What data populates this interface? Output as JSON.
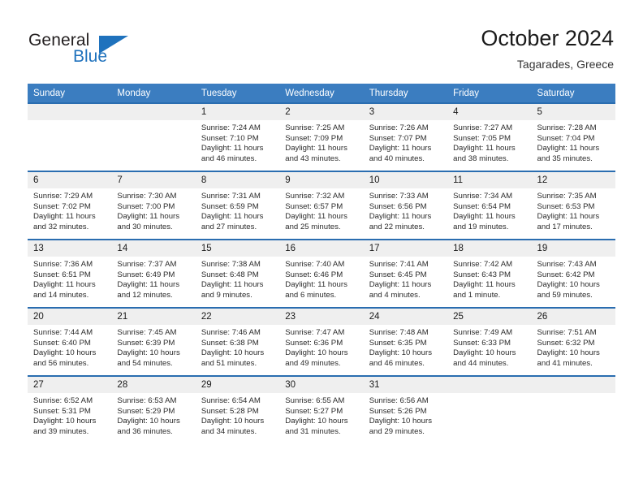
{
  "logo": {
    "text_top": "General",
    "text_bottom": "Blue",
    "accent_color": "#1f72bd"
  },
  "header": {
    "title": "October 2024",
    "location": "Tagarades, Greece"
  },
  "theme": {
    "header_row_bg": "#3b7dc0",
    "row_divider": "#2a6db0",
    "daynum_bg": "#efefef"
  },
  "calendar": {
    "weekday_headers": [
      "Sunday",
      "Monday",
      "Tuesday",
      "Wednesday",
      "Thursday",
      "Friday",
      "Saturday"
    ],
    "weeks": [
      [
        {
          "day": "",
          "sunrise": "",
          "sunset": "",
          "daylight_line1": "",
          "daylight_line2": ""
        },
        {
          "day": "",
          "sunrise": "",
          "sunset": "",
          "daylight_line1": "",
          "daylight_line2": ""
        },
        {
          "day": "1",
          "sunrise": "Sunrise: 7:24 AM",
          "sunset": "Sunset: 7:10 PM",
          "daylight_line1": "Daylight: 11 hours",
          "daylight_line2": "and 46 minutes."
        },
        {
          "day": "2",
          "sunrise": "Sunrise: 7:25 AM",
          "sunset": "Sunset: 7:09 PM",
          "daylight_line1": "Daylight: 11 hours",
          "daylight_line2": "and 43 minutes."
        },
        {
          "day": "3",
          "sunrise": "Sunrise: 7:26 AM",
          "sunset": "Sunset: 7:07 PM",
          "daylight_line1": "Daylight: 11 hours",
          "daylight_line2": "and 40 minutes."
        },
        {
          "day": "4",
          "sunrise": "Sunrise: 7:27 AM",
          "sunset": "Sunset: 7:05 PM",
          "daylight_line1": "Daylight: 11 hours",
          "daylight_line2": "and 38 minutes."
        },
        {
          "day": "5",
          "sunrise": "Sunrise: 7:28 AM",
          "sunset": "Sunset: 7:04 PM",
          "daylight_line1": "Daylight: 11 hours",
          "daylight_line2": "and 35 minutes."
        }
      ],
      [
        {
          "day": "6",
          "sunrise": "Sunrise: 7:29 AM",
          "sunset": "Sunset: 7:02 PM",
          "daylight_line1": "Daylight: 11 hours",
          "daylight_line2": "and 32 minutes."
        },
        {
          "day": "7",
          "sunrise": "Sunrise: 7:30 AM",
          "sunset": "Sunset: 7:00 PM",
          "daylight_line1": "Daylight: 11 hours",
          "daylight_line2": "and 30 minutes."
        },
        {
          "day": "8",
          "sunrise": "Sunrise: 7:31 AM",
          "sunset": "Sunset: 6:59 PM",
          "daylight_line1": "Daylight: 11 hours",
          "daylight_line2": "and 27 minutes."
        },
        {
          "day": "9",
          "sunrise": "Sunrise: 7:32 AM",
          "sunset": "Sunset: 6:57 PM",
          "daylight_line1": "Daylight: 11 hours",
          "daylight_line2": "and 25 minutes."
        },
        {
          "day": "10",
          "sunrise": "Sunrise: 7:33 AM",
          "sunset": "Sunset: 6:56 PM",
          "daylight_line1": "Daylight: 11 hours",
          "daylight_line2": "and 22 minutes."
        },
        {
          "day": "11",
          "sunrise": "Sunrise: 7:34 AM",
          "sunset": "Sunset: 6:54 PM",
          "daylight_line1": "Daylight: 11 hours",
          "daylight_line2": "and 19 minutes."
        },
        {
          "day": "12",
          "sunrise": "Sunrise: 7:35 AM",
          "sunset": "Sunset: 6:53 PM",
          "daylight_line1": "Daylight: 11 hours",
          "daylight_line2": "and 17 minutes."
        }
      ],
      [
        {
          "day": "13",
          "sunrise": "Sunrise: 7:36 AM",
          "sunset": "Sunset: 6:51 PM",
          "daylight_line1": "Daylight: 11 hours",
          "daylight_line2": "and 14 minutes."
        },
        {
          "day": "14",
          "sunrise": "Sunrise: 7:37 AM",
          "sunset": "Sunset: 6:49 PM",
          "daylight_line1": "Daylight: 11 hours",
          "daylight_line2": "and 12 minutes."
        },
        {
          "day": "15",
          "sunrise": "Sunrise: 7:38 AM",
          "sunset": "Sunset: 6:48 PM",
          "daylight_line1": "Daylight: 11 hours",
          "daylight_line2": "and 9 minutes."
        },
        {
          "day": "16",
          "sunrise": "Sunrise: 7:40 AM",
          "sunset": "Sunset: 6:46 PM",
          "daylight_line1": "Daylight: 11 hours",
          "daylight_line2": "and 6 minutes."
        },
        {
          "day": "17",
          "sunrise": "Sunrise: 7:41 AM",
          "sunset": "Sunset: 6:45 PM",
          "daylight_line1": "Daylight: 11 hours",
          "daylight_line2": "and 4 minutes."
        },
        {
          "day": "18",
          "sunrise": "Sunrise: 7:42 AM",
          "sunset": "Sunset: 6:43 PM",
          "daylight_line1": "Daylight: 11 hours",
          "daylight_line2": "and 1 minute."
        },
        {
          "day": "19",
          "sunrise": "Sunrise: 7:43 AM",
          "sunset": "Sunset: 6:42 PM",
          "daylight_line1": "Daylight: 10 hours",
          "daylight_line2": "and 59 minutes."
        }
      ],
      [
        {
          "day": "20",
          "sunrise": "Sunrise: 7:44 AM",
          "sunset": "Sunset: 6:40 PM",
          "daylight_line1": "Daylight: 10 hours",
          "daylight_line2": "and 56 minutes."
        },
        {
          "day": "21",
          "sunrise": "Sunrise: 7:45 AM",
          "sunset": "Sunset: 6:39 PM",
          "daylight_line1": "Daylight: 10 hours",
          "daylight_line2": "and 54 minutes."
        },
        {
          "day": "22",
          "sunrise": "Sunrise: 7:46 AM",
          "sunset": "Sunset: 6:38 PM",
          "daylight_line1": "Daylight: 10 hours",
          "daylight_line2": "and 51 minutes."
        },
        {
          "day": "23",
          "sunrise": "Sunrise: 7:47 AM",
          "sunset": "Sunset: 6:36 PM",
          "daylight_line1": "Daylight: 10 hours",
          "daylight_line2": "and 49 minutes."
        },
        {
          "day": "24",
          "sunrise": "Sunrise: 7:48 AM",
          "sunset": "Sunset: 6:35 PM",
          "daylight_line1": "Daylight: 10 hours",
          "daylight_line2": "and 46 minutes."
        },
        {
          "day": "25",
          "sunrise": "Sunrise: 7:49 AM",
          "sunset": "Sunset: 6:33 PM",
          "daylight_line1": "Daylight: 10 hours",
          "daylight_line2": "and 44 minutes."
        },
        {
          "day": "26",
          "sunrise": "Sunrise: 7:51 AM",
          "sunset": "Sunset: 6:32 PM",
          "daylight_line1": "Daylight: 10 hours",
          "daylight_line2": "and 41 minutes."
        }
      ],
      [
        {
          "day": "27",
          "sunrise": "Sunrise: 6:52 AM",
          "sunset": "Sunset: 5:31 PM",
          "daylight_line1": "Daylight: 10 hours",
          "daylight_line2": "and 39 minutes."
        },
        {
          "day": "28",
          "sunrise": "Sunrise: 6:53 AM",
          "sunset": "Sunset: 5:29 PM",
          "daylight_line1": "Daylight: 10 hours",
          "daylight_line2": "and 36 minutes."
        },
        {
          "day": "29",
          "sunrise": "Sunrise: 6:54 AM",
          "sunset": "Sunset: 5:28 PM",
          "daylight_line1": "Daylight: 10 hours",
          "daylight_line2": "and 34 minutes."
        },
        {
          "day": "30",
          "sunrise": "Sunrise: 6:55 AM",
          "sunset": "Sunset: 5:27 PM",
          "daylight_line1": "Daylight: 10 hours",
          "daylight_line2": "and 31 minutes."
        },
        {
          "day": "31",
          "sunrise": "Sunrise: 6:56 AM",
          "sunset": "Sunset: 5:26 PM",
          "daylight_line1": "Daylight: 10 hours",
          "daylight_line2": "and 29 minutes."
        },
        {
          "day": "",
          "sunrise": "",
          "sunset": "",
          "daylight_line1": "",
          "daylight_line2": ""
        },
        {
          "day": "",
          "sunrise": "",
          "sunset": "",
          "daylight_line1": "",
          "daylight_line2": ""
        }
      ]
    ]
  }
}
